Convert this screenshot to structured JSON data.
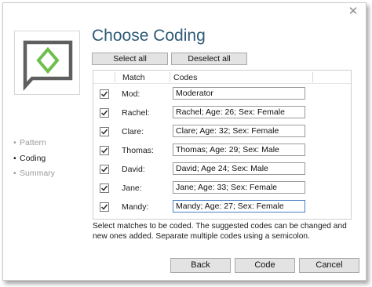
{
  "window": {
    "close_glyph": "✕",
    "title": "Choose Coding",
    "logo_icon": "speech-bubble-diamond-icon",
    "accent_color": "#2d5a77",
    "logo_green": "#6cc04a"
  },
  "toolbar": {
    "select_all_label": "Select all",
    "deselect_all_label": "Deselect all"
  },
  "steps": [
    {
      "label": "Pattern",
      "active": false
    },
    {
      "label": "Coding",
      "active": true
    },
    {
      "label": "Summary",
      "active": false
    }
  ],
  "grid": {
    "headers": {
      "match": "Match",
      "codes": "Codes"
    },
    "rows": [
      {
        "checked": true,
        "match": "Mod:",
        "code": "Moderator"
      },
      {
        "checked": true,
        "match": "Rachel:",
        "code": "Rachel; Age: 26; Sex: Female"
      },
      {
        "checked": true,
        "match": "Clare:",
        "code": "Clare; Age: 32; Sex: Female"
      },
      {
        "checked": true,
        "match": "Thomas:",
        "code": "Thomas; Age: 29; Sex: Male"
      },
      {
        "checked": true,
        "match": "David:",
        "code": "David; Age 24; Sex: Male"
      },
      {
        "checked": true,
        "match": "Jane:",
        "code": "Jane; Age: 33; Sex: Female"
      },
      {
        "checked": true,
        "match": "Mandy:",
        "code": "Mandy; Age: 27; Sex: Female"
      }
    ]
  },
  "help_text": "Select matches to be coded. The suggested codes can be changed and new ones added. Separate multiple codes using a semicolon.",
  "footer": {
    "back_label": "Back",
    "code_label": "Code",
    "cancel_label": "Cancel"
  }
}
